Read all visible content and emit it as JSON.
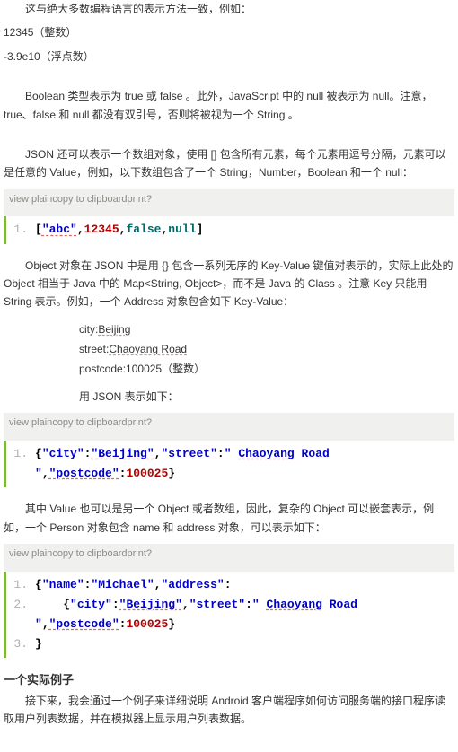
{
  "p1": "这与绝大多数编程语言的表示方法一致，例如：",
  "p2": "12345（整数）",
  "p3": "-3.9e10（浮点数）",
  "p4": "Boolean 类型表示为 true 或 false 。此外，JavaScript 中的 null 被表示为  null。注意，true、false 和 null 都没有双引号，否则将被视为一个 String 。",
  "p5": "JSON 还可以表示一个数组对象，使用 [] 包含所有元素，每个元素用逗号分隔，元素可以是任意的 Value，例如，以下数组包含了一个 String，Number，Boolean 和一个 null：",
  "toolbar": {
    "view": "view plain",
    "copy": "copy to clipboard",
    "print": "print",
    "q": "?"
  },
  "code1": {
    "l1": {
      "no": "1.",
      "t1": "[",
      "t2": "\"abc\"",
      "t3": ",",
      "t4": "12345",
      "t5": ",",
      "t6": "false",
      "t7": ",",
      "t8": "null",
      "t9": "]"
    }
  },
  "p6": "Object 对象在 JSON 中是用 {} 包含一系列无序的 Key-Value 键值对表示的，实际上此处的 Object 相当于 Java 中的 Map<String, Object>，而不是 Java 的 Class 。注意 Key 只能用 String 表示。例如，一个 Address 对象包含如下 Key-Value：",
  "kv": {
    "cityLabel": "city:",
    "cityVal": "Beijing",
    "streetLabel": "street:",
    "streetVal": "Chaoyang Road",
    "postLabel": "postcode:",
    "postVal": "100025（整数）"
  },
  "p7": "用 JSON 表示如下：",
  "code2": {
    "l1": {
      "no": "1.",
      "t1": "{",
      "t2": "\"city\"",
      "t3": ":",
      "t4": "\"Beijing\"",
      "t5": ",",
      "t6": "\"street\"",
      "t7": ":",
      "t8": "\" ",
      "t9": "Chaoyang",
      "t10": " Road \"",
      "t11": ",",
      "t12": "\"postcode\"",
      "t13": ":",
      "t14": "100025",
      "t15": "}"
    }
  },
  "p8": "其中 Value 也可以是另一个 Object 或者数组，因此，复杂的 Object 可以嵌套表示，例如，一个 Person 对象包含 name 和 address 对象，可以表示如下：",
  "code3": {
    "l1": {
      "no": "1.",
      "t1": "{",
      "t2": "\"name\"",
      "t3": ":",
      "t4": "\"Michael\"",
      "t5": ",",
      "t6": "\"address\"",
      "t7": ":"
    },
    "l2": {
      "no": "2.",
      "pad": "    ",
      "t1": "{",
      "t2": "\"city\"",
      "t3": ":",
      "t4": "\"Beijing\"",
      "t5": ",",
      "t6": "\"street\"",
      "t7": ":",
      "t8": "\" ",
      "t9": "Chaoyang",
      "t10": " Road \"",
      "t11": ",",
      "t12": "\"postcode\"",
      "t13": ":",
      "t14": "100025",
      "t15": "}"
    },
    "l3": {
      "no": "3.",
      "t1": "}"
    }
  },
  "h1": "一个实际例子",
  "p9": "接下来，我会通过一个例子来详细说明 Android 客户端程序如何访问服务端的接口程序读取用户列表数据，并在模拟器上显示用户列表数据。"
}
